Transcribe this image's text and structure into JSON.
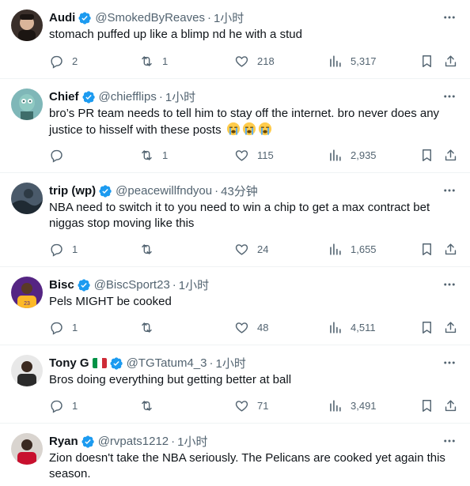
{
  "tweets": [
    {
      "name": "Audi",
      "handle": "@SmokedByReaves",
      "time": "1小时",
      "text": "stomach puffed up like a blimp nd he with a stud",
      "replies": "2",
      "reposts": "1",
      "likes": "218",
      "views": "5,317",
      "avatar_colors": [
        "#3a2f2a",
        "#d9b59a"
      ]
    },
    {
      "name": "Chief",
      "handle": "@chiefflips",
      "time": "1小时",
      "text": "bro’s PR team needs to tell him to stay off the internet. bro never does any justice to hisself with these posts",
      "emojis": [
        "loudly-crying-face",
        "loudly-crying-face",
        "loudly-crying-face"
      ],
      "replies": "",
      "reposts": "1",
      "likes": "115",
      "views": "2,935",
      "avatar_colors": [
        "#7fb7b8",
        "#3e6d6a"
      ]
    },
    {
      "name": "trip (wp)",
      "handle": "@peacewillfndyou",
      "time": "43分钟",
      "text": "NBA need to switch it to you need to win a chip to get a max contract bet niggas stop moving like this",
      "replies": "1",
      "reposts": "",
      "likes": "24",
      "views": "1,655",
      "avatar_colors": [
        "#4a5a6a",
        "#1f2a33"
      ]
    },
    {
      "name": "Bisc",
      "handle": "@BiscSport23",
      "time": "1小时",
      "text": "Pels MIGHT be cooked",
      "replies": "1",
      "reposts": "",
      "likes": "48",
      "views": "4,511",
      "avatar_colors": [
        "#552583",
        "#fdb927"
      ]
    },
    {
      "name": "Tony G",
      "handle": "@TGTatum4_3",
      "time": "1小时",
      "text": "Bros doing everything but getting better at ball",
      "flag_colors": [
        "#009246",
        "#ffffff",
        "#ce2b37"
      ],
      "replies": "1",
      "reposts": "",
      "likes": "71",
      "views": "3,491",
      "avatar_colors": [
        "#ffffff",
        "#2b2b2b"
      ]
    },
    {
      "name": "Ryan",
      "handle": "@rvpats1212",
      "time": "1小时",
      "text": "Zion doesn't take the NBA seriously. The Pelicans are cooked yet again this season.",
      "replies": "",
      "reposts": "",
      "likes": "",
      "views": "",
      "avatar_colors": [
        "#c8102e",
        "#3a2a22"
      ]
    }
  ],
  "colors": {
    "verified": "#1d9bf0",
    "secondary_text": "#536471",
    "primary_text": "#0f1419",
    "divider": "#eff3f4"
  },
  "icons": [
    "more-icon",
    "reply-icon",
    "repost-icon",
    "like-icon",
    "views-icon",
    "bookmark-icon",
    "share-icon",
    "verified-badge-icon"
  ]
}
